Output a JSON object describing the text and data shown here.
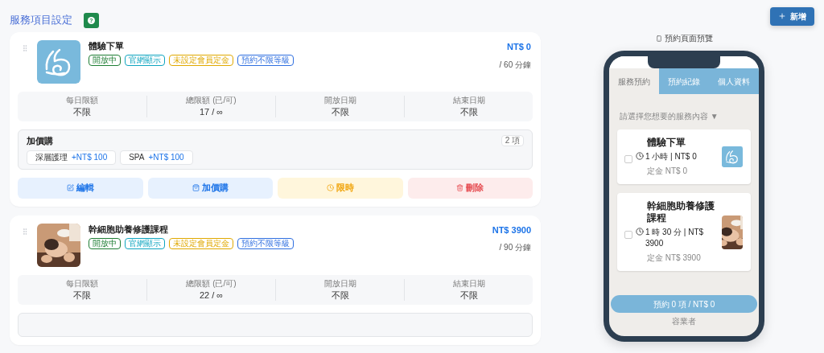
{
  "page": {
    "title": "服務項目設定",
    "help_icon": "?",
    "add_button": "新增"
  },
  "services": [
    {
      "name": "體驗下單",
      "price": "NT$ 0",
      "duration": "/ 60 分鐘",
      "tags": [
        {
          "label": "開放中",
          "color": "#1e7e34"
        },
        {
          "label": "官網顯示",
          "color": "#0fa5c0"
        },
        {
          "label": "未設定會員定金",
          "color": "#e0a800"
        },
        {
          "label": "預約不限等級",
          "color": "#2f6fe0"
        }
      ],
      "stats": [
        {
          "label": "每日限額",
          "value": "不限"
        },
        {
          "label": "總限額 (已/可)",
          "value": "17 / ∞"
        },
        {
          "label": "開放日期",
          "value": "不限"
        },
        {
          "label": "結束日期",
          "value": "不限"
        }
      ],
      "addons": {
        "title": "加價購",
        "count": "2 項",
        "items": [
          {
            "name": "深層護理",
            "price": "+NT$ 100"
          },
          {
            "name": "SPA",
            "price": "+NT$ 100"
          }
        ]
      },
      "actions": [
        {
          "label": "編輯",
          "kind": "edit"
        },
        {
          "label": "加價購",
          "kind": "addon"
        },
        {
          "label": "限時",
          "kind": "timed"
        },
        {
          "label": "刪除",
          "kind": "delete"
        }
      ]
    },
    {
      "name": "幹細胞助養修護課程",
      "price": "NT$ 3900",
      "duration": "/ 90 分鐘",
      "tags": [
        {
          "label": "開放中",
          "color": "#1e7e34"
        },
        {
          "label": "官網顯示",
          "color": "#0fa5c0"
        },
        {
          "label": "未設定會員定金",
          "color": "#e0a800"
        },
        {
          "label": "預約不限等級",
          "color": "#2f6fe0"
        }
      ],
      "stats": [
        {
          "label": "每日限額",
          "value": "不限"
        },
        {
          "label": "總限額 (已/可)",
          "value": "22 / ∞"
        },
        {
          "label": "開放日期",
          "value": "不限"
        },
        {
          "label": "結束日期",
          "value": "不限"
        }
      ]
    }
  ],
  "preview": {
    "label": "預約頁面預覽",
    "tabs": [
      {
        "label": "服務預約",
        "selected": true
      },
      {
        "label": "預約紀錄",
        "selected": false
      },
      {
        "label": "個人資料",
        "selected": false
      }
    ],
    "prompt": "請選擇您想要的服務內容 ▼",
    "items": [
      {
        "name": "體驗下單",
        "detail": "1 小時 | NT$ 0",
        "deposit": "定金 NT$ 0",
        "checked": false
      },
      {
        "name": "幹細胞助養修護課程",
        "detail": "1 時 30 分 | NT$ 3900",
        "deposit": "定金 NT$ 3900",
        "checked": false
      }
    ],
    "book_button": "預約 0 項 / NT$ 0",
    "footer": "容業者"
  }
}
